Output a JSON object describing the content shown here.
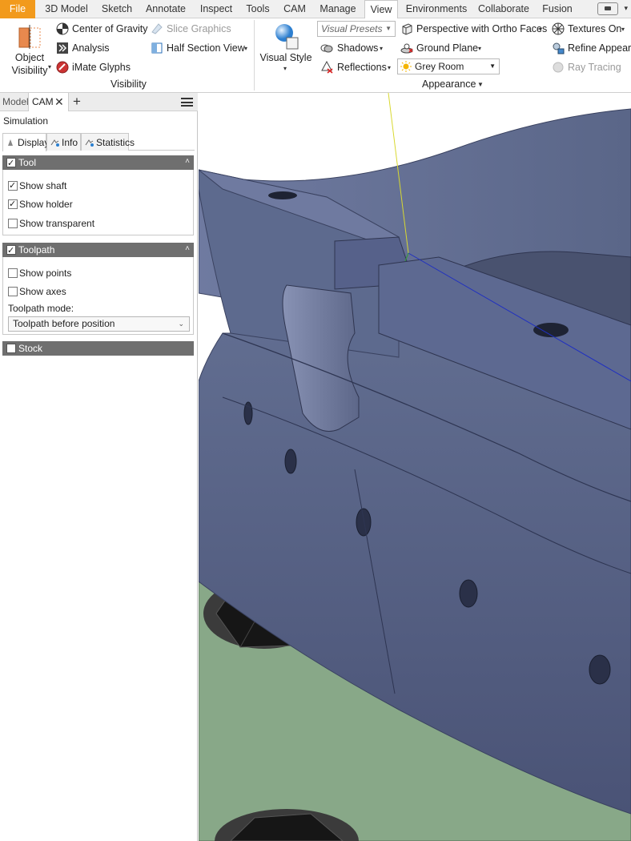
{
  "menu": {
    "tabs": [
      "File",
      "3D Model",
      "Sketch",
      "Annotate",
      "Inspect",
      "Tools",
      "CAM",
      "Manage",
      "View",
      "Environments",
      "Collaborate",
      "Fusion"
    ],
    "active": "View"
  },
  "ribbon": {
    "visibility": {
      "object_visibility": "Object\nVisibility",
      "object_visibility_l1": "Object",
      "object_visibility_l2": "Visibility",
      "center_of_gravity": "Center of Gravity",
      "analysis": "Analysis",
      "imate_glyphs": "iMate Glyphs",
      "slice_graphics": "Slice Graphics",
      "half_section_view": "Half Section View",
      "title": "Visibility"
    },
    "appearance": {
      "visual_style": "Visual Style",
      "visual_presets": "Visual Presets",
      "shadows": "Shadows",
      "reflections": "Reflections",
      "perspective": "Perspective with Ortho Faces",
      "ground_plane": "Ground Plane",
      "grey_room": "Grey Room",
      "textures_on": "Textures On",
      "refine_appearance": "Refine Appeara",
      "ray_tracing": "Ray Tracing",
      "title": "Appearance"
    }
  },
  "browser": {
    "tabs": {
      "model": "Model",
      "cam": "CAM"
    },
    "simulation_label": "Simulation",
    "sub_tabs": {
      "display": "Display",
      "info": "Info",
      "statistics": "Statistics"
    },
    "tool_section": {
      "title": "Tool",
      "checked": true,
      "options": [
        {
          "label": "Show shaft",
          "checked": true
        },
        {
          "label": "Show holder",
          "checked": true
        },
        {
          "label": "Show transparent",
          "checked": false
        }
      ]
    },
    "toolpath_section": {
      "title": "Toolpath",
      "checked": true,
      "options": [
        {
          "label": "Show points",
          "checked": false
        },
        {
          "label": "Show axes",
          "checked": false
        }
      ],
      "mode_label": "Toolpath mode:",
      "mode_value": "Toolpath before position"
    },
    "stock_section": {
      "title": "Stock",
      "checked": false
    }
  },
  "colors": {
    "file_tab": "#f29a1c",
    "part_blue": "#5a6688",
    "fixture_green": "#88a888",
    "section_header": "#6f6f6f"
  }
}
